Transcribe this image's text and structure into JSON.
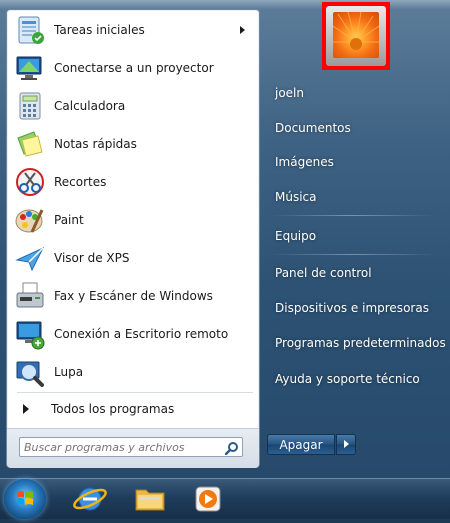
{
  "programs": [
    {
      "label": "Tareas iniciales",
      "icon": "getting-started-icon",
      "has_submenu": true
    },
    {
      "label": "Conectarse a un proyector",
      "icon": "projector-icon",
      "has_submenu": false
    },
    {
      "label": "Calculadora",
      "icon": "calculator-icon",
      "has_submenu": false
    },
    {
      "label": "Notas rápidas",
      "icon": "sticky-notes-icon",
      "has_submenu": false
    },
    {
      "label": "Recortes",
      "icon": "snipping-tool-icon",
      "has_submenu": false
    },
    {
      "label": "Paint",
      "icon": "paint-icon",
      "has_submenu": false
    },
    {
      "label": "Visor de XPS",
      "icon": "xps-viewer-icon",
      "has_submenu": false
    },
    {
      "label": "Fax y Escáner de Windows",
      "icon": "fax-scanner-icon",
      "has_submenu": false
    },
    {
      "label": "Conexión a Escritorio remoto",
      "icon": "remote-desktop-icon",
      "has_submenu": false
    },
    {
      "label": "Lupa",
      "icon": "magnifier-icon",
      "has_submenu": false
    }
  ],
  "all_programs_label": "Todos los programas",
  "search": {
    "placeholder": "Buscar programas y archivos"
  },
  "right_items": [
    {
      "label": "joeln"
    },
    {
      "label": "Documentos"
    },
    {
      "label": "Imágenes"
    },
    {
      "label": "Música"
    },
    {
      "label": "Equipo"
    },
    {
      "label": "Panel de control"
    },
    {
      "label": "Dispositivos e impresoras"
    },
    {
      "label": "Programas predeterminados"
    },
    {
      "label": "Ayuda y soporte técnico"
    }
  ],
  "shutdown_label": "Apagar",
  "colors": {
    "highlight_frame": "#ff0000",
    "menu_blue": "#2d5274"
  },
  "taskbar": {
    "icons": [
      "start-orb-icon",
      "internet-explorer-icon",
      "windows-explorer-icon",
      "media-player-icon"
    ]
  }
}
